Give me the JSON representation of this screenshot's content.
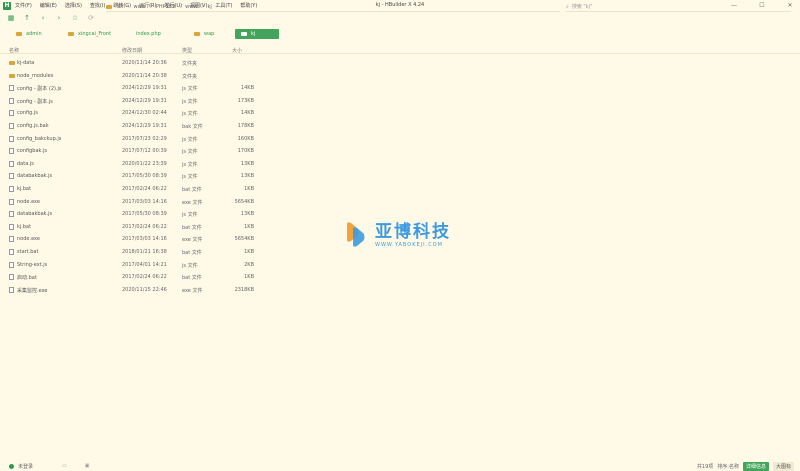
{
  "window": {
    "title": "kj - HBuilder X 4.24"
  },
  "menu": [
    "文件(F)",
    "编辑(E)",
    "选择(S)",
    "查找(I)",
    "跳转(G)",
    "运行(R)",
    "发行(U)",
    "视图(V)",
    "工具(T)",
    "帮助(Y)"
  ],
  "app_logo": "H",
  "window_controls": {
    "minimize": "—",
    "maximize": "☐",
    "close": "✕"
  },
  "path": [
    "D:",
    "www",
    "PHP189",
    "www",
    "kj"
  ],
  "search": {
    "placeholder": "搜索 \"kj\""
  },
  "tabs": [
    {
      "label": "admin",
      "active": false
    },
    {
      "label": "xingcai_Front",
      "active": false
    },
    {
      "label": "index.php",
      "active": false
    },
    {
      "label": "wap",
      "active": false
    },
    {
      "label": "kj",
      "active": true
    }
  ],
  "columns": {
    "name": "名称",
    "date": "修改日期",
    "type": "类型",
    "size": "大小"
  },
  "files": [
    {
      "name": "kj-data",
      "date": "2020/11/14 20:36",
      "type": "文件夹",
      "size": "",
      "kind": "folder"
    },
    {
      "name": "node_modules",
      "date": "2020/11/14 20:38",
      "type": "文件夹",
      "size": "",
      "kind": "folder"
    },
    {
      "name": "config - 副本 (2).js",
      "date": "2024/12/29 19:31",
      "type": "js 文件",
      "size": "14KB",
      "kind": "file"
    },
    {
      "name": "config - 副本.js",
      "date": "2024/12/29 19:31",
      "type": "js 文件",
      "size": "173KB",
      "kind": "file"
    },
    {
      "name": "config.js",
      "date": "2024/12/30 02:44",
      "type": "js 文件",
      "size": "14KB",
      "kind": "file"
    },
    {
      "name": "config.js.bak",
      "date": "2024/12/29 19:31",
      "type": "bak 文件",
      "size": "178KB",
      "kind": "file"
    },
    {
      "name": "config_bakckup.js",
      "date": "2017/07/23 02:29",
      "type": "js 文件",
      "size": "160KB",
      "kind": "file"
    },
    {
      "name": "configbak.js",
      "date": "2017/07/12 00:39",
      "type": "js 文件",
      "size": "170KB",
      "kind": "file"
    },
    {
      "name": "data.js",
      "date": "2020/01/22 23:39",
      "type": "js 文件",
      "size": "13KB",
      "kind": "file"
    },
    {
      "name": "databakbak.js",
      "date": "2017/05/30 08:39",
      "type": "js 文件",
      "size": "13KB",
      "kind": "file"
    },
    {
      "name": "kj.bat",
      "date": "2017/02/24 06:22",
      "type": "bat 文件",
      "size": "1KB",
      "kind": "file"
    },
    {
      "name": "node.exe",
      "date": "2017/03/03 14:16",
      "type": "exe 文件",
      "size": "5654KB",
      "kind": "file"
    },
    {
      "name": "databakbak.js",
      "date": "2017/05/30 08:39",
      "type": "js 文件",
      "size": "13KB",
      "kind": "file"
    },
    {
      "name": "kj.bat",
      "date": "2017/02/24 06:22",
      "type": "bat 文件",
      "size": "1KB",
      "kind": "file"
    },
    {
      "name": "node.exe",
      "date": "2017/03/03 14:16",
      "type": "exe 文件",
      "size": "5654KB",
      "kind": "file"
    },
    {
      "name": "start.bat",
      "date": "2018/01/21 16:38",
      "type": "bat 文件",
      "size": "1KB",
      "kind": "file"
    },
    {
      "name": "String-ext.js",
      "date": "2017/04/01 14:21",
      "type": "js 文件",
      "size": "2KB",
      "kind": "file"
    },
    {
      "name": "启动.bat",
      "date": "2017/02/24 06:22",
      "type": "bat 文件",
      "size": "1KB",
      "kind": "file"
    },
    {
      "name": "采集监控.exe",
      "date": "2020/11/15 22:46",
      "type": "exe 文件",
      "size": "2318KB",
      "kind": "file"
    }
  ],
  "watermark": {
    "name": "亚博科技",
    "url": "WWW.YABOKEJI.COM"
  },
  "status": {
    "login": "未登录",
    "items_count": "共19项",
    "sort": "排序:名称",
    "mode_badge": "详细信息",
    "view_badge": "大图标"
  },
  "colors": {
    "accent": "#43a55b",
    "background": "#fffae8",
    "folder": "#d8a63c",
    "watermark": "#3c9ae0"
  }
}
